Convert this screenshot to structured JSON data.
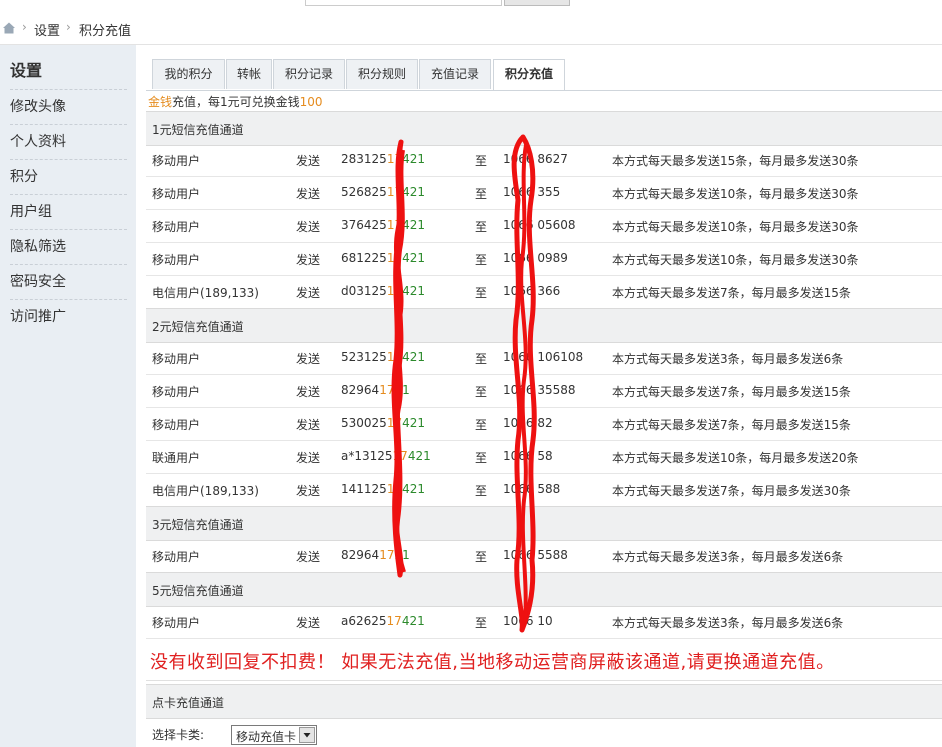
{
  "breadcrumb": {
    "items": [
      "设置",
      "积分充值"
    ]
  },
  "sidebar": {
    "title": "设置",
    "items": [
      "修改头像",
      "个人资料",
      "积分",
      "用户组",
      "隐私筛选",
      "密码安全",
      "访问推广"
    ]
  },
  "tabs": [
    "我的积分",
    "转帐",
    "积分记录",
    "积分规则",
    "充值记录",
    "积分充值"
  ],
  "intro": {
    "currency": "金钱",
    "text": "充值，每1元可兑换金钱",
    "amount": "100"
  },
  "sections": [
    {
      "title": "1元短信充值通道",
      "rows": [
        {
          "user": "移动用户",
          "send": "发送",
          "code_a": "283125",
          "code_b": "17",
          "code_c": "421",
          "to": "至",
          "num": "1066 8627",
          "desc": "本方式每天最多发送15条，每月最多发送30条"
        },
        {
          "user": "移动用户",
          "send": "发送",
          "code_a": "526825",
          "code_b": "17",
          "code_c": "421",
          "to": "至",
          "num": "1066 355",
          "desc": "本方式每天最多发送10条，每月最多发送30条"
        },
        {
          "user": "移动用户",
          "send": "发送",
          "code_a": "376425",
          "code_b": "17",
          "code_c": "421",
          "to": "至",
          "num": "1066 05608",
          "desc": "本方式每天最多发送10条，每月最多发送30条"
        },
        {
          "user": "移动用户",
          "send": "发送",
          "code_a": "681225",
          "code_b": "17",
          "code_c": "421",
          "to": "至",
          "num": "1066 0989",
          "desc": "本方式每天最多发送10条，每月最多发送30条"
        },
        {
          "user": "电信用户(189,133)",
          "send": "发送",
          "code_a": "d03125",
          "code_b": "17",
          "code_c": "421",
          "to": "至",
          "num": "1066 366",
          "desc": "本方式每天最多发送7条，每月最多发送15条"
        }
      ]
    },
    {
      "title": "2元短信充值通道",
      "rows": [
        {
          "user": "移动用户",
          "send": "发送",
          "code_a": "523125",
          "code_b": "17",
          "code_c": "421",
          "to": "至",
          "num": "1066 106108",
          "desc": "本方式每天最多发送3条，每月最多发送6条"
        },
        {
          "user": "移动用户",
          "send": "发送",
          "code_a": "82964",
          "code_b": "17",
          "code_c": "21",
          "to": "至",
          "num": "1066 35588",
          "desc": "本方式每天最多发送7条，每月最多发送15条"
        },
        {
          "user": "移动用户",
          "send": "发送",
          "code_a": "530025",
          "code_b": "17",
          "code_c": "421",
          "to": "至",
          "num": "1066 82",
          "desc": "本方式每天最多发送7条，每月最多发送15条"
        },
        {
          "user": "联通用户",
          "send": "发送",
          "code_a": "a*13125",
          "code_b": "17",
          "code_c": "421",
          "to": "至",
          "num": "1066 58",
          "desc": "本方式每天最多发送10条，每月最多发送20条"
        },
        {
          "user": "电信用户(189,133)",
          "send": "发送",
          "code_a": "141125",
          "code_b": "17",
          "code_c": "421",
          "to": "至",
          "num": "1066 588",
          "desc": "本方式每天最多发送7条，每月最多发送30条"
        }
      ]
    },
    {
      "title": "3元短信充值通道",
      "rows": [
        {
          "user": "移动用户",
          "send": "发送",
          "code_a": "82964",
          "code_b": "17",
          "code_c": "21",
          "to": "至",
          "num": "1066 5588",
          "desc": "本方式每天最多发送3条，每月最多发送6条"
        }
      ]
    },
    {
      "title": "5元短信充值通道",
      "rows": [
        {
          "user": "移动用户",
          "send": "发送",
          "code_a": "a62625",
          "code_b": "17",
          "code_c": "421",
          "to": "至",
          "num": "1066 10",
          "desc": "本方式每天最多发送3条，每月最多发送6条"
        }
      ]
    }
  ],
  "notice": "没有收到回复不扣费！ 如果无法充值,当地移动运营商屏蔽该通道,请更换通道充值。",
  "card": {
    "title": "点卡充值通道",
    "select_label": "选择卡类:",
    "selected": "移动充值卡"
  },
  "colors": {
    "accent_orange": "#e58c1f",
    "code_green": "#2c8a2c",
    "notice_red": "#e02020",
    "scribble_red": "#ee1111"
  }
}
